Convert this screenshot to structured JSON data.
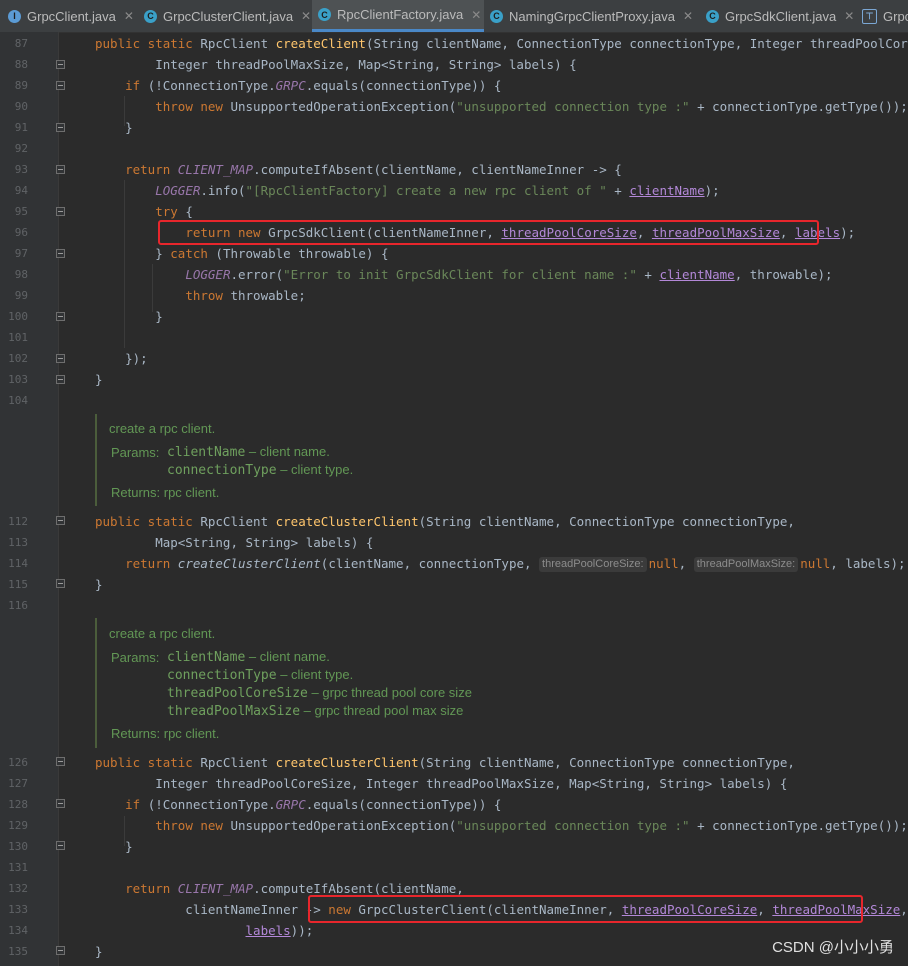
{
  "tabs": [
    {
      "label": "GrpcClient.java",
      "icon": "class-icon",
      "active": false
    },
    {
      "label": "GrpcClusterClient.java",
      "icon": "class-icon",
      "active": false
    },
    {
      "label": "RpcClientFactory.java",
      "icon": "class-icon",
      "active": true
    },
    {
      "label": "NamingGrpcClientProxy.java",
      "icon": "class-icon",
      "active": false
    },
    {
      "label": "GrpcSdkClient.java",
      "icon": "class-icon",
      "active": false
    },
    {
      "label": "Grpc",
      "icon": "structure-icon",
      "active": false
    }
  ],
  "close_glyph": "✕",
  "line_numbers": [
    "87",
    "88",
    "89",
    "90",
    "91",
    "92",
    "93",
    "94",
    "95",
    "96",
    "97",
    "98",
    "99",
    "100",
    "101",
    "102",
    "103",
    "104",
    "112",
    "113",
    "114",
    "115",
    "116",
    "126",
    "127",
    "128",
    "129",
    "130",
    "131",
    "132",
    "133",
    "134",
    "135"
  ],
  "doc1": {
    "summary": "create a rpc client.",
    "params_label": "Params:",
    "params": [
      {
        "name": "clientName",
        "desc": " – client name."
      },
      {
        "name": "connectionType",
        "desc": " – client type."
      }
    ],
    "returns": "Returns: rpc client."
  },
  "doc2": {
    "summary": "create a rpc client.",
    "params_label": "Params:",
    "params": [
      {
        "name": "clientName",
        "desc": " – client name."
      },
      {
        "name": "connectionType",
        "desc": " – client type."
      },
      {
        "name": "threadPoolCoreSize",
        "desc": " – grpc thread pool core size"
      },
      {
        "name": "threadPoolMaxSize",
        "desc": " – grpc thread pool max size"
      }
    ],
    "returns": "Returns: rpc client."
  },
  "hints": {
    "core": "threadPoolCoreSize:",
    "max": "threadPoolMaxSize:"
  },
  "watermark": "CSDN @小小小勇",
  "colors": {
    "background": "#2b2b2b",
    "gutter": "#313335",
    "keyword": "#cc7832",
    "method": "#ffc66d",
    "string": "#6a8759",
    "constant": "#9876aa",
    "highlight_box": "#e8262c"
  }
}
